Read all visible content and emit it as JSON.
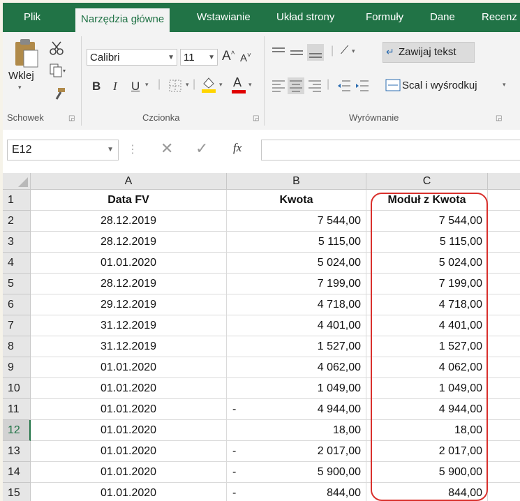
{
  "tabs": [
    "Plik",
    "Narzędzia główne",
    "Wstawianie",
    "Układ strony",
    "Formuły",
    "Dane",
    "Recenz"
  ],
  "active_tab": "Narzędzia główne",
  "ribbon": {
    "clipboard": {
      "paste_label": "Wklej",
      "group_label": "Schowek"
    },
    "font": {
      "font_name": "Calibri",
      "font_size": "11",
      "bold": "B",
      "italic": "I",
      "underline": "U",
      "grow": "A",
      "shrink": "A",
      "font_color": "A",
      "group_label": "Czcionka"
    },
    "alignment": {
      "wrap_text": "Zawijaj tekst",
      "merge_center": "Scal i wyśrodkuj",
      "group_label": "Wyrównanie"
    }
  },
  "formula_bar": {
    "name_box": "E12",
    "fx": "fx",
    "formula": ""
  },
  "columns": [
    "A",
    "B",
    "C"
  ],
  "selected_row": "12",
  "header_row": {
    "row": "1",
    "a": "Data FV",
    "b": "Kwota",
    "c": "Moduł z Kwota"
  },
  "rows": [
    {
      "row": "2",
      "a": "28.12.2019",
      "b_sign": "",
      "b": "7 544,00",
      "c": "7 544,00"
    },
    {
      "row": "3",
      "a": "28.12.2019",
      "b_sign": "",
      "b": "5 115,00",
      "c": "5 115,00"
    },
    {
      "row": "4",
      "a": "01.01.2020",
      "b_sign": "",
      "b": "5 024,00",
      "c": "5 024,00"
    },
    {
      "row": "5",
      "a": "28.12.2019",
      "b_sign": "",
      "b": "7 199,00",
      "c": "7 199,00"
    },
    {
      "row": "6",
      "a": "29.12.2019",
      "b_sign": "",
      "b": "4 718,00",
      "c": "4 718,00"
    },
    {
      "row": "7",
      "a": "31.12.2019",
      "b_sign": "",
      "b": "4 401,00",
      "c": "4 401,00"
    },
    {
      "row": "8",
      "a": "31.12.2019",
      "b_sign": "",
      "b": "1 527,00",
      "c": "1 527,00"
    },
    {
      "row": "9",
      "a": "01.01.2020",
      "b_sign": "",
      "b": "4 062,00",
      "c": "4 062,00"
    },
    {
      "row": "10",
      "a": "01.01.2020",
      "b_sign": "",
      "b": "1 049,00",
      "c": "1 049,00"
    },
    {
      "row": "11",
      "a": "01.01.2020",
      "b_sign": "-",
      "b": "4 944,00",
      "c": "4 944,00"
    },
    {
      "row": "12",
      "a": "01.01.2020",
      "b_sign": "",
      "b": "18,00",
      "c": "18,00"
    },
    {
      "row": "13",
      "a": "01.01.2020",
      "b_sign": "-",
      "b": "2 017,00",
      "c": "2 017,00"
    },
    {
      "row": "14",
      "a": "01.01.2020",
      "b_sign": "-",
      "b": "5 900,00",
      "c": "5 900,00"
    },
    {
      "row": "15",
      "a": "01.01.2020",
      "b_sign": "-",
      "b": "844,00",
      "c": "844,00"
    }
  ],
  "colors": {
    "accent": "#217346",
    "highlight": "#d9302c"
  }
}
